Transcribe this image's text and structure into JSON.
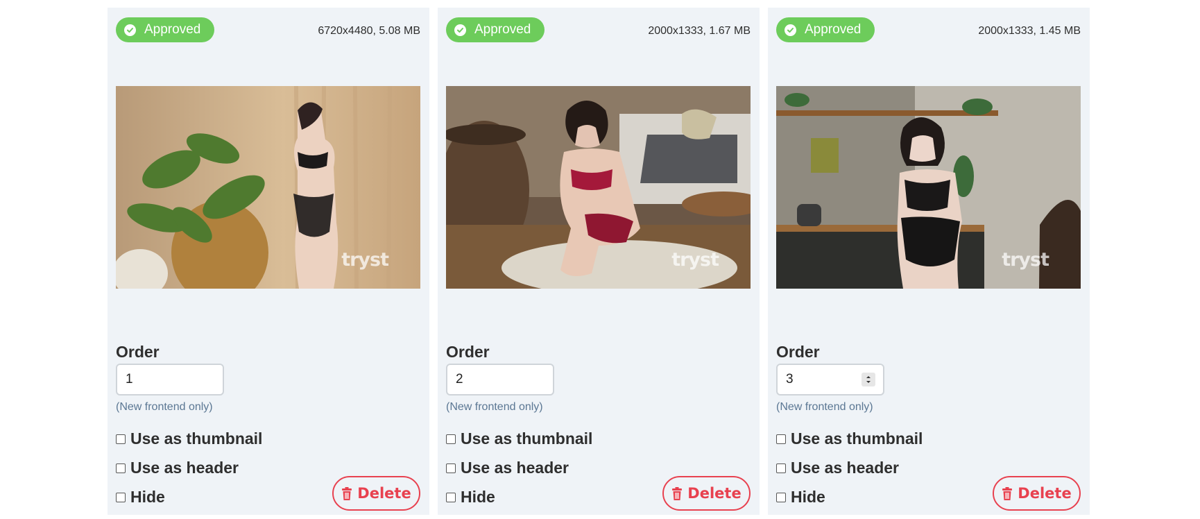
{
  "colors": {
    "approved": "#6dcc5b",
    "delete": "#e8414f",
    "card_bg": "#eff3f7",
    "hint": "#5b7793"
  },
  "cards": [
    {
      "status": "Approved",
      "dimensions": "6720x4480, 5.08 MB",
      "watermark": "tryst",
      "order_label": "Order",
      "order_value": "1",
      "hint": "(New frontend only)",
      "thumbnail_label": "Use as thumbnail",
      "header_label": "Use as header",
      "hide_label": "Hide",
      "delete_label": "Delete"
    },
    {
      "status": "Approved",
      "dimensions": "2000x1333, 1.67 MB",
      "watermark": "tryst",
      "order_label": "Order",
      "order_value": "2",
      "hint": "(New frontend only)",
      "thumbnail_label": "Use as thumbnail",
      "header_label": "Use as header",
      "hide_label": "Hide",
      "delete_label": "Delete"
    },
    {
      "status": "Approved",
      "dimensions": "2000x1333, 1.45 MB",
      "watermark": "tryst",
      "order_label": "Order",
      "order_value": "3",
      "hint": "(New frontend only)",
      "thumbnail_label": "Use as thumbnail",
      "header_label": "Use as header",
      "hide_label": "Hide",
      "delete_label": "Delete"
    }
  ]
}
